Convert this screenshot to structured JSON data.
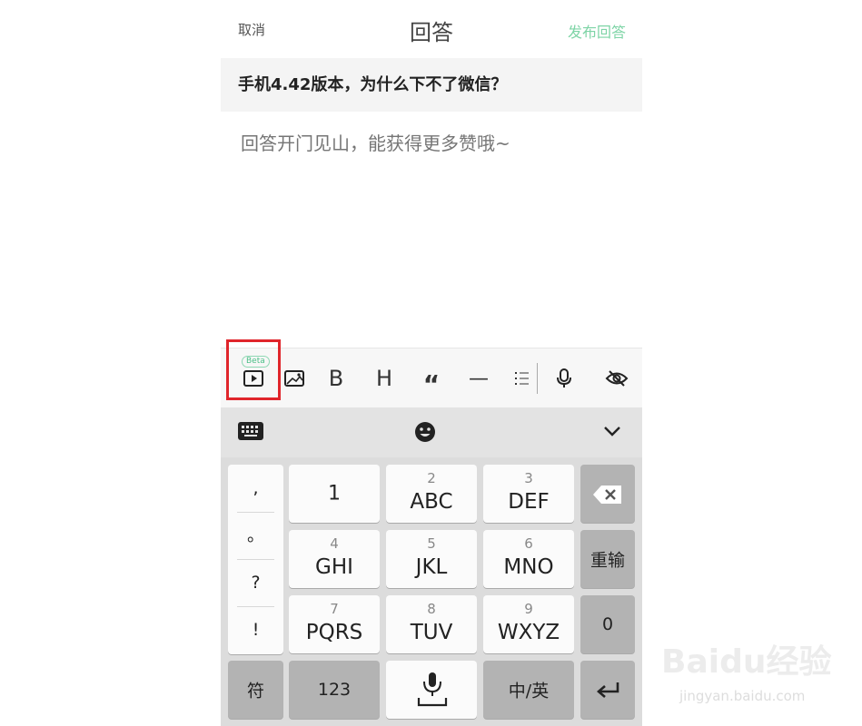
{
  "header": {
    "cancel": "取消",
    "title": "回答",
    "publish": "发布回答"
  },
  "question": "手机4.42版本，为什么下不了微信？",
  "answer": {
    "placeholder": "回答开门见山，能获得更多赞哦~"
  },
  "toolbar": {
    "beta": "Beta",
    "items": [
      "video-icon",
      "image-icon",
      "bold",
      "heading",
      "quote",
      "divider",
      "list",
      "microphone-icon",
      "hide-icon"
    ],
    "bold": "B",
    "heading": "H",
    "quote": "“",
    "divider": "—"
  },
  "keyboard_bar": {
    "icons": [
      "keyboard-icon",
      "emoji-icon",
      "chevron-down-icon"
    ]
  },
  "keyboard": {
    "punct": [
      ",",
      "。",
      "?",
      "!"
    ],
    "keys": [
      {
        "num": "",
        "letters": "1"
      },
      {
        "num": "2",
        "letters": "ABC"
      },
      {
        "num": "3",
        "letters": "DEF"
      },
      {
        "num": "4",
        "letters": "GHI"
      },
      {
        "num": "5",
        "letters": "JKL"
      },
      {
        "num": "6",
        "letters": "MNO"
      },
      {
        "num": "7",
        "letters": "PQRS"
      },
      {
        "num": "8",
        "letters": "TUV"
      },
      {
        "num": "9",
        "letters": "WXYZ"
      }
    ],
    "reenter": "重输",
    "zero": "0",
    "symbol": "符",
    "num_mode": "123",
    "lang": "中/英"
  },
  "watermark": {
    "brand": "Baidu经验",
    "url": "jingyan.baidu.com"
  },
  "colors": {
    "accent": "#7ed4a6",
    "highlight": "#e0252b"
  }
}
